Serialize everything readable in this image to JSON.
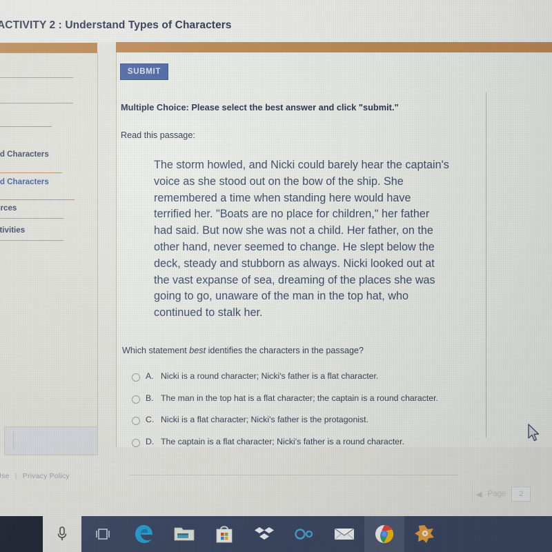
{
  "header": {
    "activity_title": "ACTIVITY 2 : Understand Types of Characters"
  },
  "sidebar": {
    "items": [
      {
        "label": "Understand\nCharacters",
        "truncated_label": "derstand\nCharacters",
        "state": "normal"
      },
      {
        "label": "Understand\nCharacters",
        "truncated_label": "derstand\nCharacters",
        "state": "active"
      },
      {
        "label": "Student Resources",
        "truncated_label": "t Resources",
        "state": "normal"
      },
      {
        "label": "Additional Activities",
        "truncated_label": "onal Activities",
        "state": "normal"
      }
    ]
  },
  "footer": {
    "terms_label": "of Use",
    "separator": "|",
    "privacy_label": "Privacy Policy"
  },
  "main": {
    "submit_label": "SUBMIT",
    "instruction": "Multiple Choice: Please select the best answer and click \"submit.\"",
    "read_prompt": "Read this passage:",
    "passage": "The storm howled, and Nicki could barely hear the captain's voice as she stood out on the bow of the ship. She remembered a time when standing here would have terrified her. \"Boats are no place for children,\" her father had said. But now she was not a child. Her father, on the other hand, never seemed to change. He slept below the deck, steady and stubborn as always. Nicki looked out at the vast expanse of sea, dreaming of the places she was going to go, unaware of the man in the top hat, who continued to stalk her.",
    "question_prefix": "Which statement ",
    "question_emphasis": "best",
    "question_suffix": " identifies the characters in the passage?",
    "options": [
      {
        "letter": "A.",
        "text": "Nicki is a round character; Nicki's father is a flat character.",
        "selected": false
      },
      {
        "letter": "B.",
        "text": "The man in the top hat is a flat character; the captain is a round character.",
        "selected": false
      },
      {
        "letter": "C.",
        "text": "Nicki is a flat character; Nicki's father is the protagonist.",
        "selected": false
      },
      {
        "letter": "D.",
        "text": "The captain is a flat character; Nicki's father is a round character.",
        "selected": false
      }
    ]
  },
  "pager": {
    "label": "Page",
    "value": "2"
  },
  "taskbar": {
    "items": [
      {
        "name": "microphone-icon",
        "label": "Cortana microphone"
      },
      {
        "name": "task-view-icon",
        "label": "Task View"
      },
      {
        "name": "edge-icon",
        "label": "Microsoft Edge"
      },
      {
        "name": "file-explorer-icon",
        "label": "File Explorer"
      },
      {
        "name": "microsoft-store-icon",
        "label": "Microsoft Store"
      },
      {
        "name": "dropbox-icon",
        "label": "Dropbox"
      },
      {
        "name": "infinity-icon",
        "label": "Infinity app"
      },
      {
        "name": "mail-icon",
        "label": "Mail"
      },
      {
        "name": "chrome-icon",
        "label": "Google Chrome"
      },
      {
        "name": "avast-icon",
        "label": "Avast"
      }
    ]
  },
  "colors": {
    "accent_orange": "#c28c55",
    "submit_blue": "#4e6aa6",
    "passage_text": "#41526f",
    "heading_text": "#2f3a55",
    "taskbar": "#3e4a66"
  }
}
